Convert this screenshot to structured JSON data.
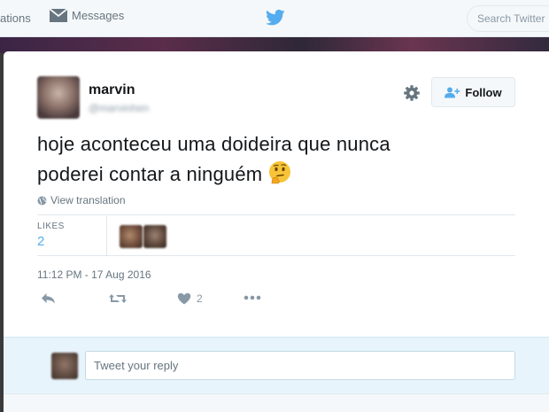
{
  "nav": {
    "notifications_partial": "ations",
    "messages_label": "Messages",
    "search_placeholder": "Search Twitter"
  },
  "tweet": {
    "author_name": "marvin",
    "author_handle": "@marvinhen",
    "follow_label": "Follow",
    "text_line1": "hoje aconteceu uma doideira que nunca",
    "text_line2": "poderei contar a ninguém",
    "emoji": "thinking-face",
    "view_translation": "View translation",
    "likes_label": "LIKES",
    "likes_count": "2",
    "timestamp": "11:12 PM - 17 Aug 2016",
    "like_action_count": "2"
  },
  "reply": {
    "placeholder": "Tweet your reply"
  },
  "colors": {
    "accent": "#55acee",
    "text": "#14171a",
    "muted": "#66757f"
  }
}
